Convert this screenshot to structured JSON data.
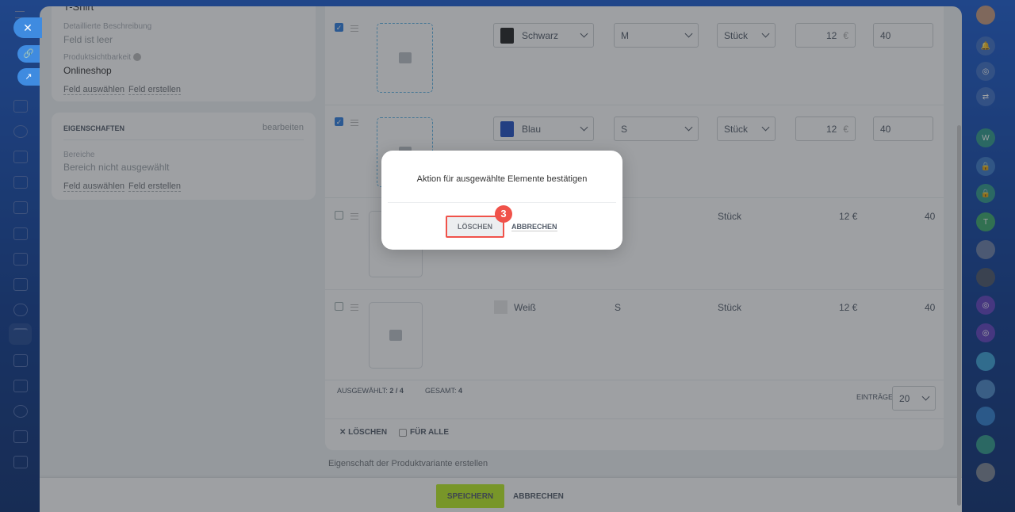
{
  "left_card": {
    "title_partial": "T-Shirt",
    "desc_label": "Detaillierte Beschreibung",
    "desc_value": "Feld ist leer",
    "vis_label": "Produktsichtbarkeit",
    "vis_value": "Onlineshop",
    "select_field": "Feld auswählen",
    "create_field": "Feld erstellen"
  },
  "properties": {
    "title": "EIGENSCHAFTEN",
    "edit": "bearbeiten",
    "areas_label": "Bereiche",
    "areas_value": "Bereich nicht ausgewählt",
    "select_field": "Feld auswählen",
    "create_field": "Feld erstellen"
  },
  "rows": [
    {
      "checked": true,
      "color": "Schwarz",
      "swatch": "#222222",
      "size": "M",
      "unit": "Stück",
      "price": "12",
      "currency": "€",
      "qty": "40"
    },
    {
      "checked": true,
      "color": "Blau",
      "swatch": "#1f4fc4",
      "size": "S",
      "unit": "Stück",
      "price": "12",
      "currency": "€",
      "qty": "40"
    },
    {
      "checked": false,
      "color": "",
      "size": "",
      "unit": "Stück",
      "price": "12 €",
      "qty": "40"
    },
    {
      "checked": false,
      "color": "Weiß",
      "swatch": "#e8e8e8",
      "size": "S",
      "unit": "Stück",
      "price": "12 €",
      "qty": "40"
    }
  ],
  "footer": {
    "selected_label": "AUSGEWÄHLT:",
    "selected_value": "2 / 4",
    "total_label": "GESAMT:",
    "total_value": "4",
    "entries_label": "EINTRÄGE",
    "entries_value": "20",
    "delete": "LÖSCHEN",
    "for_all": "FÜR ALLE"
  },
  "create_property": "Eigenschaft der Produktvariante erstellen",
  "bottom": {
    "save": "SPEICHERN",
    "cancel": "ABBRECHEN"
  },
  "modal": {
    "message": "Aktion für ausgewählte Elemente bestätigen",
    "confirm": "LÖSCHEN",
    "cancel": "ABBRECHEN",
    "step_badge": "3"
  },
  "right_bar": {
    "w": "W",
    "t": "T"
  }
}
